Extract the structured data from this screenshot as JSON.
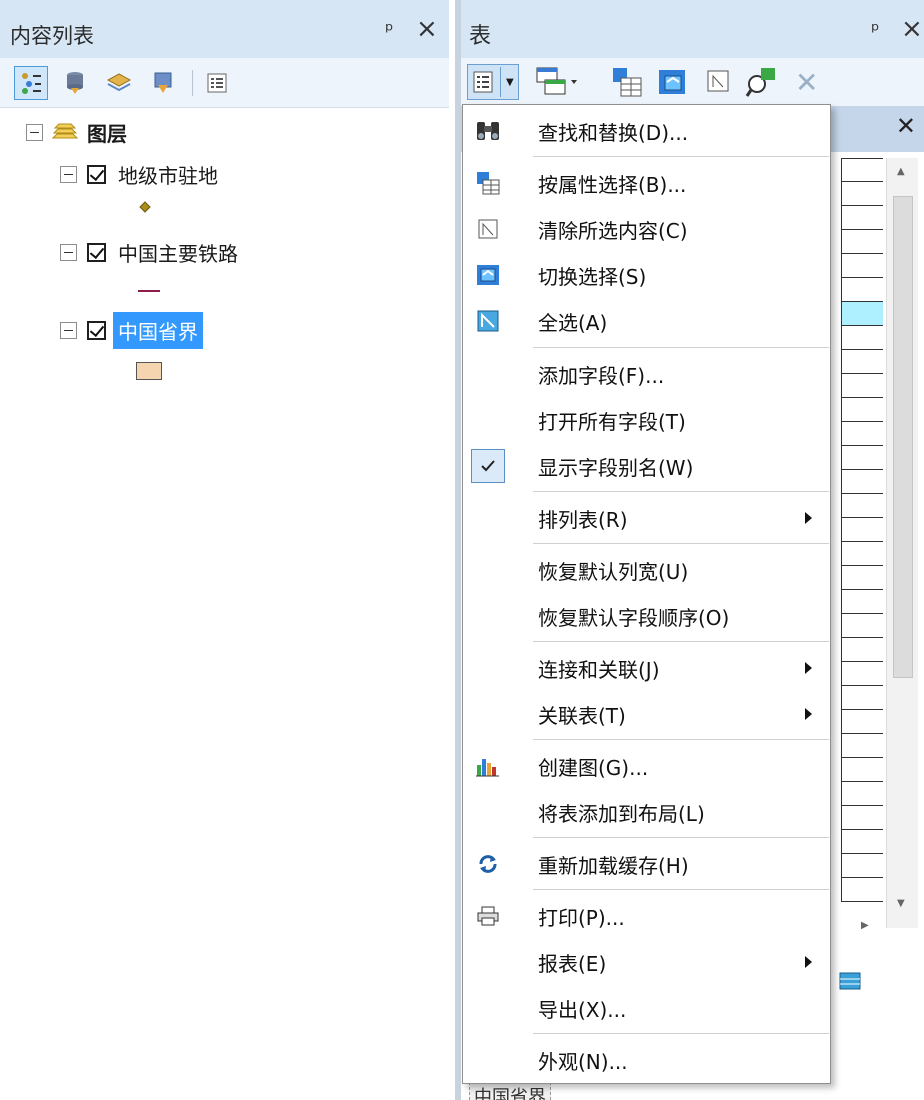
{
  "toc": {
    "title": "内容列表",
    "root_layer": "图层",
    "layers": [
      {
        "name": "地级市驻地",
        "symbol": "diamond-point",
        "checked": true,
        "selected": false
      },
      {
        "name": "中国主要铁路",
        "symbol": "line",
        "checked": true,
        "selected": false
      },
      {
        "name": "中国省界",
        "symbol": "polygon",
        "checked": true,
        "selected": true
      }
    ]
  },
  "table_window": {
    "title": "表",
    "bottom_tab": "中国省界"
  },
  "menu": {
    "items": [
      {
        "label": "查找和替换(D)...",
        "icon": "binoculars-icon"
      },
      {
        "label": "按属性选择(B)...",
        "icon": "select-by-attributes-icon"
      },
      {
        "label": "清除所选内容(C)",
        "icon": "clear-selection-icon"
      },
      {
        "label": "切换选择(S)",
        "icon": "switch-selection-icon"
      },
      {
        "label": "全选(A)",
        "icon": "select-all-icon"
      },
      {
        "label": "添加字段(F)..."
      },
      {
        "label": "打开所有字段(T)"
      },
      {
        "label": "显示字段别名(W)",
        "checked": true
      },
      {
        "label": "排列表(R)",
        "submenu": true
      },
      {
        "label": "恢复默认列宽(U)"
      },
      {
        "label": "恢复默认字段顺序(O)"
      },
      {
        "label": "连接和关联(J)",
        "submenu": true
      },
      {
        "label": "关联表(T)",
        "submenu": true
      },
      {
        "label": "创建图(G)...",
        "icon": "chart-icon"
      },
      {
        "label": "将表添加到布局(L)"
      },
      {
        "label": "重新加载缓存(H)",
        "icon": "reload-icon"
      },
      {
        "label": "打印(P)...",
        "icon": "printer-icon"
      },
      {
        "label": "报表(E)",
        "submenu": true
      },
      {
        "label": "导出(X)..."
      },
      {
        "label": "外观(N)..."
      }
    ]
  },
  "colors": {
    "titlebar": "#d7e6f5",
    "selection": "#3399ff",
    "highlight_row": "#aef0ff",
    "polygon_fill": "#f5d5b0"
  }
}
